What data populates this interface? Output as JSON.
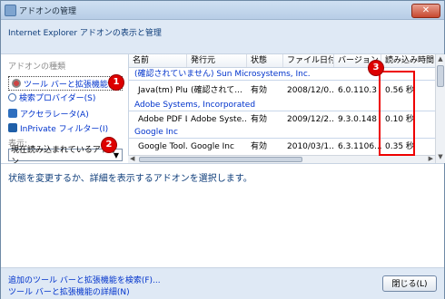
{
  "window": {
    "title": "アドオンの管理",
    "close_glyph": "✕"
  },
  "subtitle": "Internet Explorer アドオンの表示と管理",
  "sidebar": {
    "group_title": "アドオンの種類",
    "items": [
      {
        "label": "ツール バーと拡張機能(T)"
      },
      {
        "label": "検索プロバイダー(S)"
      },
      {
        "label": "アクセラレータ(A)"
      },
      {
        "label": "InPrivate フィルター(I)"
      }
    ],
    "show_label": "表示:",
    "show_value": "現在読み込まれているアドオン"
  },
  "table": {
    "columns": [
      "名前",
      "発行元",
      "状態",
      "ファイル日付",
      "バージョン",
      "読み込み時間"
    ],
    "groups": [
      {
        "name": "(確認されていません) Sun Microsystems, Inc.",
        "rows": [
          {
            "name": "Java(tm) Plu...",
            "publisher": "(確認されて...",
            "status": "有効",
            "date": "2008/12/0...",
            "version": "6.0.110.3",
            "load": "0.56 秒"
          }
        ]
      },
      {
        "name": "Adobe Systems, Incorporated",
        "rows": [
          {
            "name": "Adobe PDF L...",
            "publisher": "Adobe Syste...",
            "status": "有効",
            "date": "2009/12/2...",
            "version": "9.3.0.148",
            "load": "0.10 秒"
          }
        ]
      },
      {
        "name": "Google Inc",
        "rows": [
          {
            "name": "Google Tool...",
            "publisher": "Google Inc",
            "status": "有効",
            "date": "2010/03/1...",
            "version": "6.3.1106....",
            "load": "0.35 秒"
          }
        ]
      }
    ]
  },
  "detail_text": "状態を変更するか、詳細を表示するアドオンを選択します。",
  "footer": {
    "link_find": "追加のツール バーと拡張機能を検索(F)...",
    "link_learn": "ツール バーと拡張機能の詳細(N)",
    "close_label": "閉じる(L)"
  },
  "callouts": [
    "1",
    "2",
    "3"
  ],
  "colors": {
    "callout": "#dd0000",
    "link": "#0033cc",
    "accent": "#0e3d7a"
  }
}
